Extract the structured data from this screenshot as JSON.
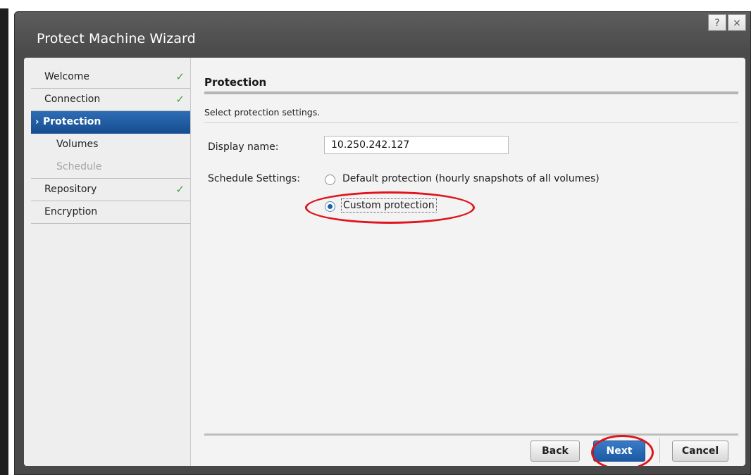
{
  "dialog": {
    "title": "Protect Machine Wizard",
    "help_label": "?",
    "close_label": "×"
  },
  "nav": {
    "items": [
      {
        "label": "Welcome",
        "state": "completed",
        "check": "✓"
      },
      {
        "label": "Connection",
        "state": "completed",
        "check": "✓"
      },
      {
        "label": "Protection",
        "state": "active",
        "arrow": "›"
      },
      {
        "label": "Volumes",
        "state": "sub"
      },
      {
        "label": "Schedule",
        "state": "sub-disabled"
      },
      {
        "label": "Repository",
        "state": "completed",
        "check": "✓"
      },
      {
        "label": "Encryption",
        "state": "normal"
      }
    ]
  },
  "content": {
    "section_title": "Protection",
    "subtitle": "Select protection settings.",
    "display_name_label": "Display name:",
    "display_name_value": "10.250.242.127",
    "schedule_label": "Schedule Settings:",
    "options": [
      {
        "label": "Default protection (hourly snapshots of all volumes)",
        "selected": false
      },
      {
        "label": "Custom protection",
        "selected": true
      }
    ]
  },
  "buttons": {
    "back": "Back",
    "next": "Next",
    "cancel": "Cancel"
  },
  "colors": {
    "annotation": "#e0141c",
    "accent": "#1f5fa8",
    "check": "#43a33b"
  }
}
